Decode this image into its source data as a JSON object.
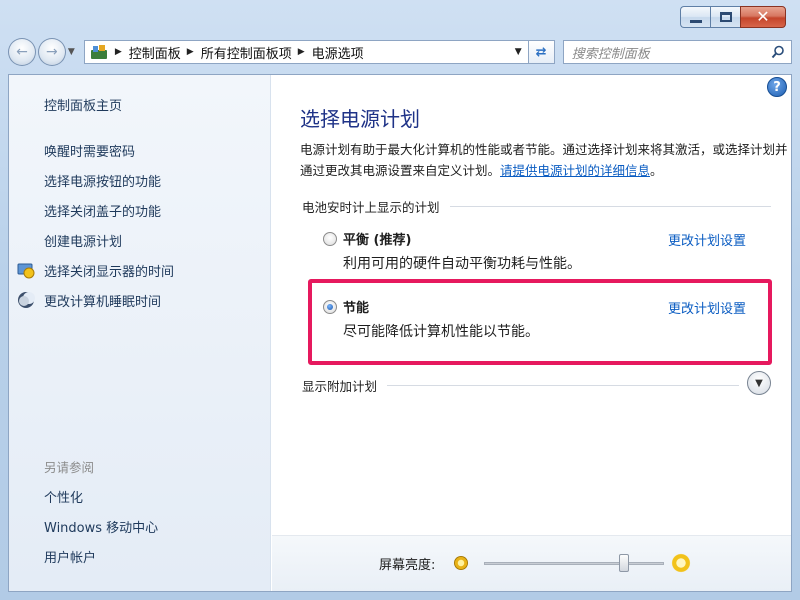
{
  "window": {
    "controls": {
      "minimize": "—",
      "maximize": "□",
      "close": "✕"
    }
  },
  "nav": {
    "back_icon": "back-arrow-icon",
    "forward_icon": "forward-arrow-icon",
    "breadcrumb": [
      "控制面板",
      "所有控制面板项",
      "电源选项"
    ],
    "search_placeholder": "搜索控制面板"
  },
  "sidebar": {
    "home": "控制面板主页",
    "links": [
      {
        "label": "唤醒时需要密码",
        "icon": null
      },
      {
        "label": "选择电源按钮的功能",
        "icon": null
      },
      {
        "label": "选择关闭盖子的功能",
        "icon": null
      },
      {
        "label": "创建电源计划",
        "icon": null
      },
      {
        "label": "选择关闭显示器的时间",
        "icon": "monitor-icon"
      },
      {
        "label": "更改计算机睡眠时间",
        "icon": "moon-icon"
      }
    ],
    "see_also": {
      "heading": "另请参阅",
      "links": [
        "个性化",
        "Windows 移动中心",
        "用户帐户"
      ]
    }
  },
  "main": {
    "title": "选择电源计划",
    "description": "电源计划有助于最大化计算机的性能或者节能。通过选择计划来将其激活，或选择计划并通过更改其电源设置来自定义计划。",
    "description_link": "请提供电源计划的详细信息",
    "description_end": "。",
    "group_label": "电池安时计上显示的计划",
    "plans": [
      {
        "name": "平衡 (推荐)",
        "description": "利用可用的硬件自动平衡功耗与性能。",
        "link": "更改计划设置",
        "selected": false
      },
      {
        "name": "节能",
        "description": "尽可能降低计算机性能以节能。",
        "link": "更改计划设置",
        "selected": true
      }
    ],
    "show_more": "显示附加计划",
    "highlight_color": "#e6195e"
  },
  "footer": {
    "brightness_label": "屏幕亮度:",
    "brightness_level": 0.78
  }
}
